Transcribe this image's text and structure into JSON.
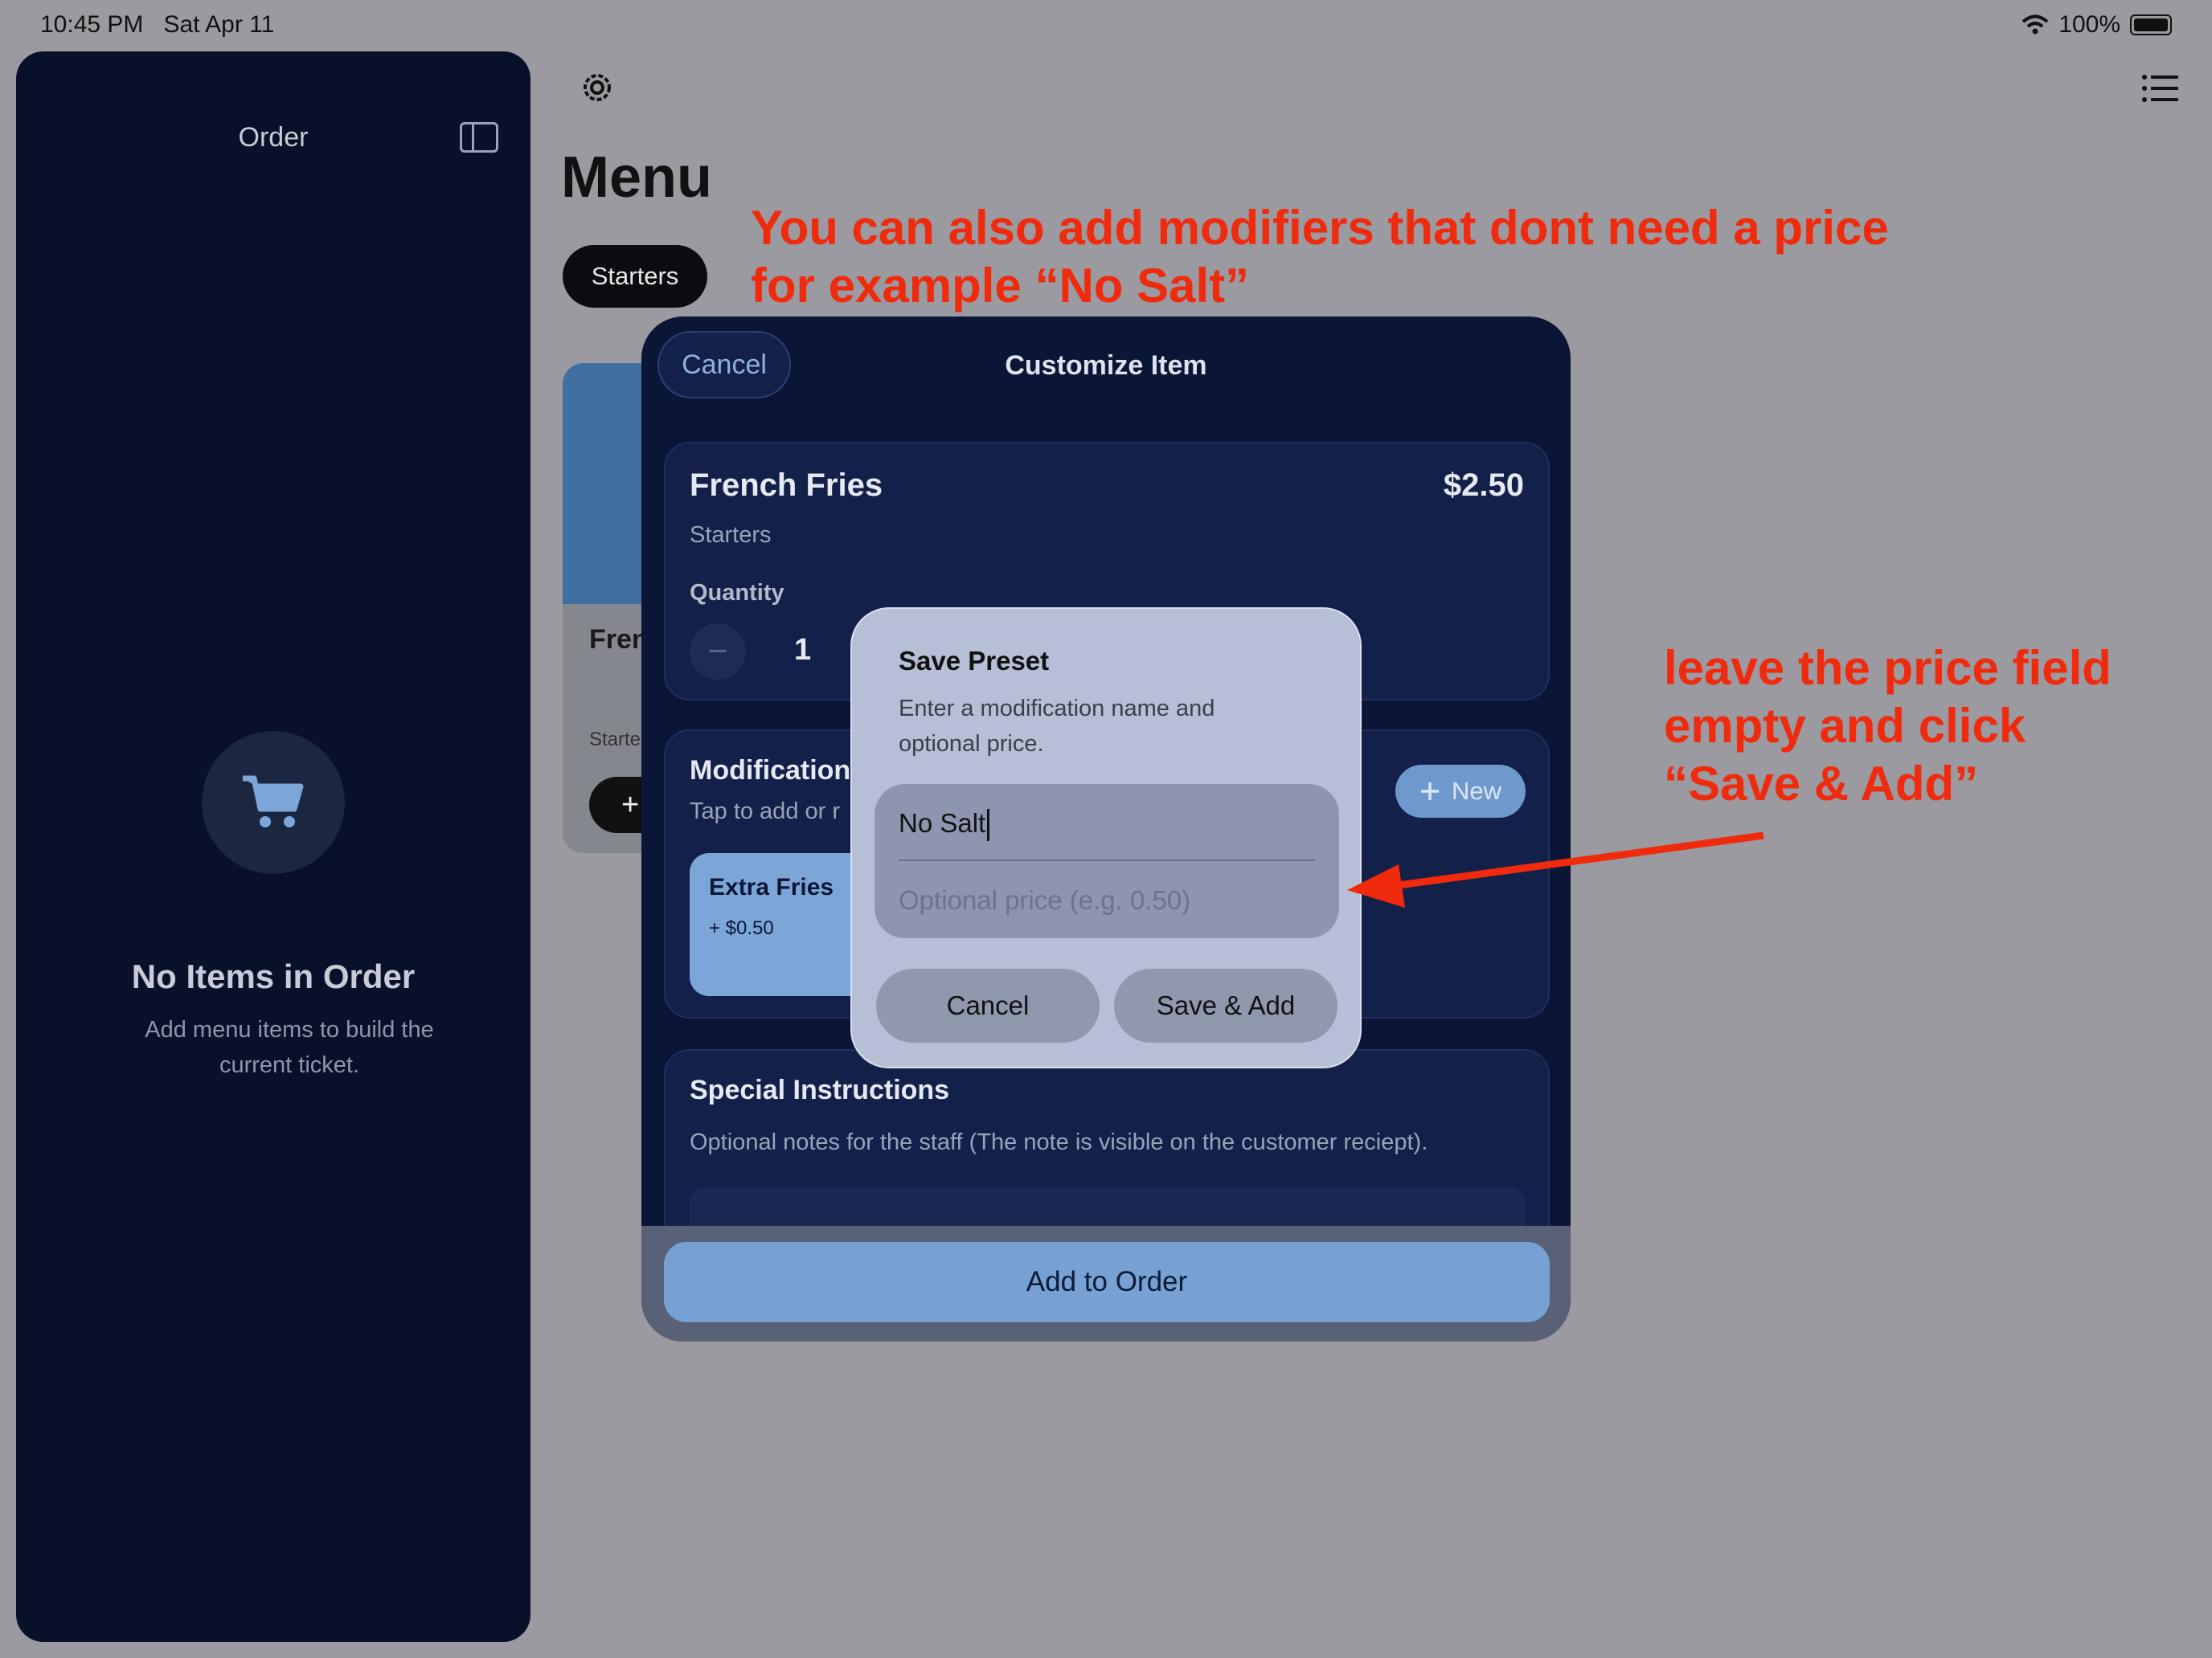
{
  "status_bar": {
    "time": "10:45 PM",
    "date": "Sat Apr 11",
    "battery": "100%",
    "icons": [
      "wifi-icon",
      "battery-icon"
    ]
  },
  "sidebar": {
    "title": "Order",
    "toggle_icon": "sidebar-toggle-icon",
    "empty_icon": "cart-icon",
    "empty_title": "No Items in Order",
    "empty_subtitle": "Add menu items to build the current ticket."
  },
  "header": {
    "title": "Menu",
    "settings_icon": "gear-icon",
    "list_icon": "list-icon"
  },
  "categories": [
    "Starters"
  ],
  "background_card": {
    "name": "Fren",
    "category": "Starte",
    "add_label": "+"
  },
  "annotations": {
    "top": "You can also add modifiers that dont need a price for example “No Salt”",
    "right": "leave the price field empty and click “Save & Add”"
  },
  "sheet": {
    "cancel_label": "Cancel",
    "title": "Customize Item",
    "item": {
      "name": "French Fries",
      "price": "$2.50",
      "category": "Starters"
    },
    "quantity_label": "Quantity",
    "quantity_value": "1",
    "minus_label": "−",
    "modifications": {
      "title": "Modifications",
      "subtitle": "Tap to add or r",
      "new_label": "New",
      "items": [
        {
          "name": "Extra Fries",
          "price": "+ $0.50"
        }
      ]
    },
    "special_instructions": {
      "title": "Special Instructions",
      "subtitle": "Optional notes for the staff (The note is visible on the customer reciept)."
    },
    "add_button": "Add to Order"
  },
  "dialog": {
    "title": "Save Preset",
    "message": "Enter a modification name and optional price.",
    "name_value": "No Salt",
    "price_placeholder": "Optional price (e.g. 0.50)",
    "cancel_label": "Cancel",
    "save_label": "Save & Add"
  },
  "colors": {
    "annotation": "#f02a0c",
    "sheet_bg": "#0b1535",
    "accent": "#76a1d2"
  }
}
